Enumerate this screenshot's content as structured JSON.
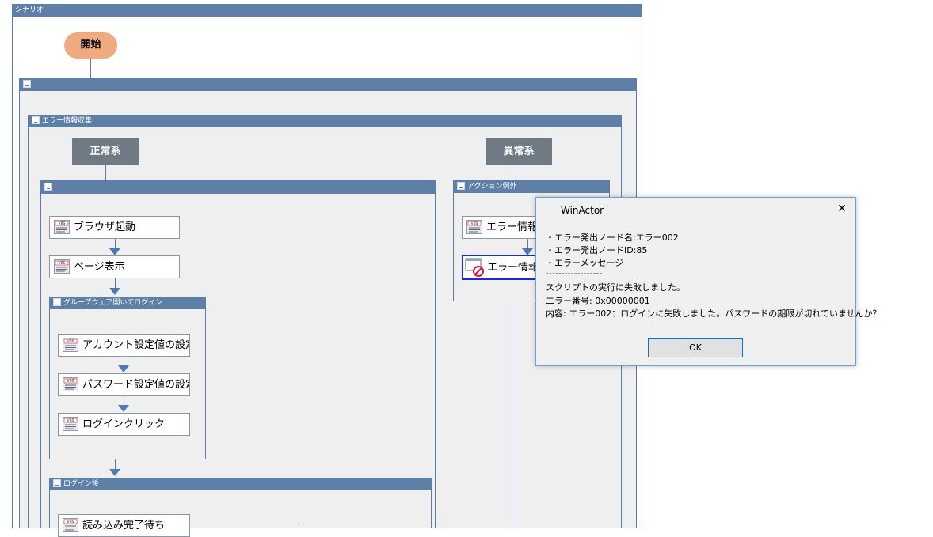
{
  "scenario": {
    "title": "シナリオ"
  },
  "flow": {
    "start_label": "開始",
    "group_root_title": "",
    "error_info_group_title": "エラー情報収集",
    "normal_branch_label": "正常系",
    "abnormal_branch_label": "異常系",
    "normal_group_title": "",
    "action_exception_title": "アクション例外",
    "nodes": {
      "browser_launch": "ブラウザ起動",
      "page_display": "ページ表示",
      "account_setting": "アカウント設定値の設定",
      "password_setting": "パスワード設定値の設定",
      "login_click": "ログインクリック",
      "wait_load": "読み込み完了待ち",
      "error_info_collect": "エラー情報収集",
      "error_info_display": "エラー情報表示"
    },
    "groupware_login_title": "グループウェア開いてログイン",
    "after_login_title": "ログイン後"
  },
  "dialog": {
    "title": "WinActor",
    "close": "✕",
    "lines": [
      "・エラー発出ノード名:エラー002",
      "・エラー発出ノードID:85",
      "・エラーメッセージ",
      "------------------",
      "スクリプトの実行に失敗しました。",
      "エラー番号: 0x00000001",
      "内容: エラー002：ログインに失敗しました。パスワードの期限が切れていませんか？"
    ],
    "ok_label": "OK"
  },
  "colors": {
    "titlebar": "#5e7fa6",
    "start": "#f0aa80",
    "branch": "#6f7a85",
    "selected_border": "#1a2bd6",
    "dialog_border": "#6ea0d8"
  }
}
